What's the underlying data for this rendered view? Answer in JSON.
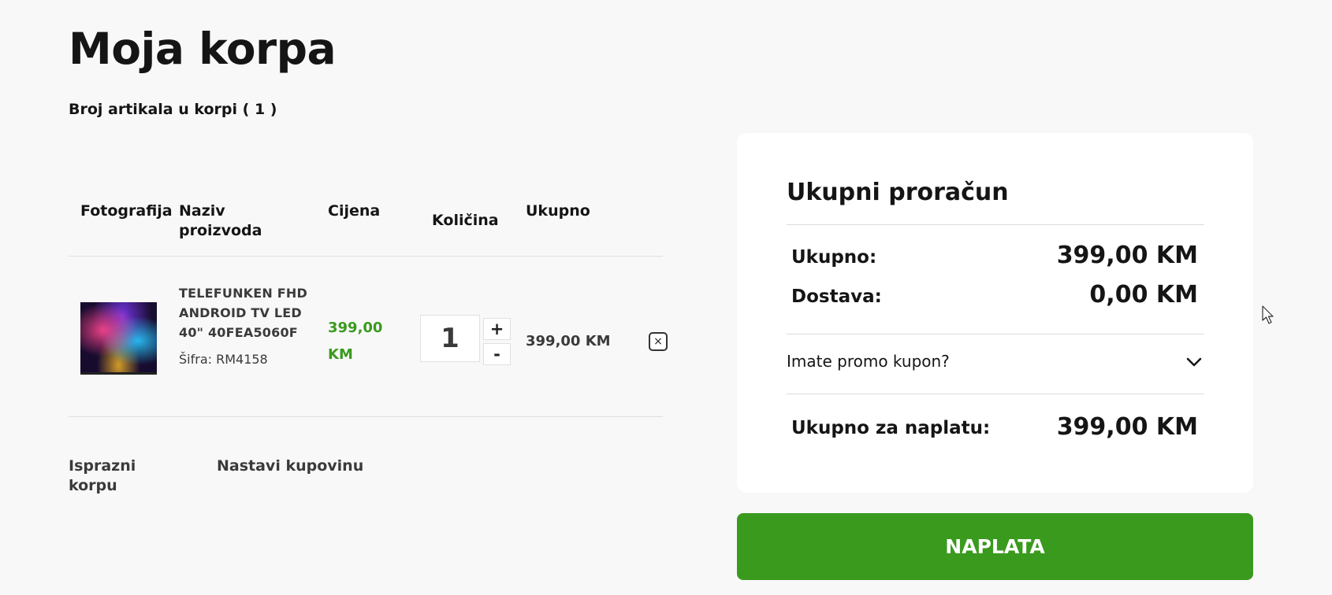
{
  "page": {
    "title": "Moja korpa",
    "item_count": "Broj artikala u korpi ( 1 )"
  },
  "table": {
    "headers": {
      "photo": "Fotografija",
      "name": "Naziv proizvoda",
      "price": "Cijena",
      "quantity": "Količina",
      "total": "Ukupno"
    },
    "rows": [
      {
        "name": "TELEFUNKEN FHD ANDROID TV LED 40\" 40FEA5060F",
        "sku": "Šifra: RM4158",
        "price": "399,00 KM",
        "quantity": "1",
        "total": "399,00 KM",
        "increment": "+",
        "decrement": "-",
        "remove": "×"
      }
    ]
  },
  "actions": {
    "empty_cart": "Isprazni korpu",
    "continue_shopping": "Nastavi kupovinu"
  },
  "summary": {
    "title": "Ukupni proračun",
    "subtotal_label": "Ukupno:",
    "subtotal_value": "399,00 KM",
    "shipping_label": "Dostava:",
    "shipping_value": "0,00 KM",
    "promo_label": "Imate promo kupon?",
    "grand_total_label": "Ukupno za naplatu:",
    "grand_total_value": "399,00 KM"
  },
  "checkout": {
    "label": "NAPLATA"
  },
  "colors": {
    "accent": "#3a9a1e",
    "background": "#f8f8f8"
  }
}
